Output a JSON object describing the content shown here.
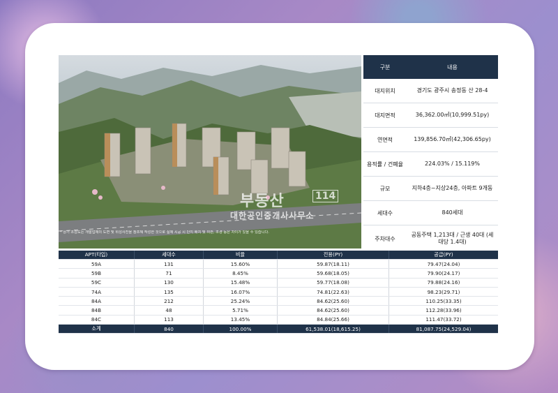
{
  "photo": {
    "caption": "* 상기 조감도는 개발업체의 도면 및 위성사진을 참조해 작성한 것으로 실제 시공 시 단지 배치 및 외관, 조경 등은 차이가 있을 수 있습니다.",
    "watermark_logo": "부동산",
    "watermark_number": "114",
    "watermark_sub": "대한공인중개사사무소"
  },
  "info": {
    "header": {
      "label": "구분",
      "value": "내용"
    },
    "rows": [
      {
        "label": "대지위치",
        "value": "경기도 광주시 송정동 산 28-4"
      },
      {
        "label": "대지면적",
        "value": "36,362.00㎡(10,999.51py)"
      },
      {
        "label": "연면적",
        "value": "139,856.70㎡(42,306.65py)"
      },
      {
        "label": "용적률 / 건폐율",
        "value": "224.03% / 15.119%"
      },
      {
        "label": "규모",
        "value": "지하4층~지상24층, 아파트 9개동"
      },
      {
        "label": "세대수",
        "value": "840세대"
      },
      {
        "label": "주차대수",
        "value": "공동주택 1,213대 / 근생 40대 (세대당 1.4대)"
      }
    ]
  },
  "units": {
    "headers": [
      "APT(타입)",
      "세대수",
      "비율",
      "전용(PY)",
      "공급(PY)"
    ],
    "rows": [
      [
        "59A",
        "131",
        "15.60%",
        "59.87(18.11)",
        "79.47(24.04)"
      ],
      [
        "59B",
        "71",
        "8.45%",
        "59.68(18.05)",
        "79.90(24.17)"
      ],
      [
        "59C",
        "130",
        "15.48%",
        "59.77(18.08)",
        "79.88(24.16)"
      ],
      [
        "74A",
        "135",
        "16.07%",
        "74.81(22.63)",
        "98.23(29.71)"
      ],
      [
        "84A",
        "212",
        "25.24%",
        "84.62(25.60)",
        "110.25(33.35)"
      ],
      [
        "84B",
        "48",
        "5.71%",
        "84.62(25.60)",
        "112.28(33.96)"
      ],
      [
        "84C",
        "113",
        "13.45%",
        "84.84(25.66)",
        "111.47(33.72)"
      ]
    ],
    "total": [
      "소계",
      "840",
      "100.00%",
      "61,538.01(18,615.25)",
      "81,087.75(24,529.04)"
    ]
  },
  "colors": {
    "header_navy": "#1f3249",
    "card": "#ffffff"
  }
}
